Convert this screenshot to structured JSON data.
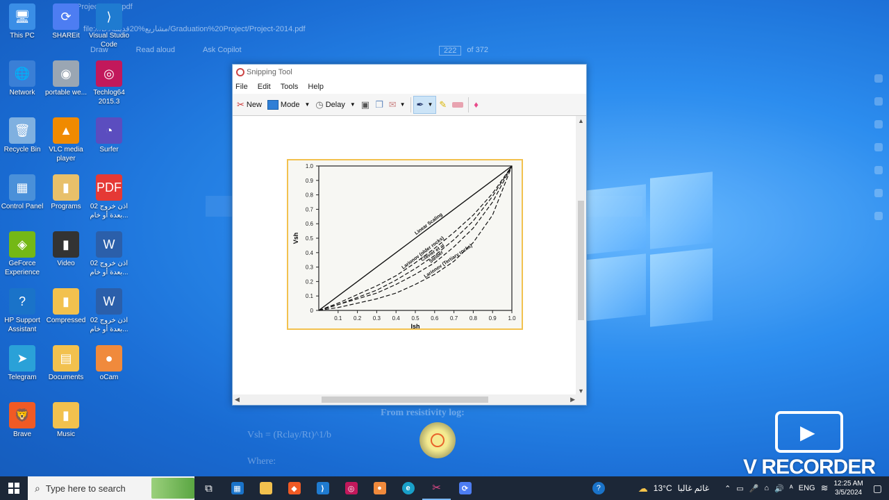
{
  "browser": {
    "tab_title": "Project-2014.pdf",
    "address": "file:///D:/مشاريع%20قديمة/Graduation%20Project/Project-2014.pdf",
    "toolbar": [
      "Draw",
      "Read aloud",
      "Ask Copilot"
    ],
    "page_current": "222",
    "page_total": "of 372",
    "doc_heading": "From resistivity log:",
    "doc_formula": "Vsh = (Rclay/Rt)^1/b",
    "doc_where": "Where:"
  },
  "desktop_icons": [
    {
      "label": "This PC",
      "color": "#3a8ee6",
      "glyph": "🖥"
    },
    {
      "label": "SHAREit",
      "color": "#4d7df2",
      "glyph": "⟳"
    },
    {
      "label": "Visual Studio Code",
      "color": "#1f7bd0",
      "glyph": "⟩"
    },
    {
      "label": "Network",
      "color": "#3a7fd6",
      "glyph": "🌐"
    },
    {
      "label": "portable we...",
      "color": "#9aa6b3",
      "glyph": "◉"
    },
    {
      "label": "Techlog64 2015.3",
      "color": "#c2185b",
      "glyph": "◎"
    },
    {
      "label": "Recycle Bin",
      "color": "#7fb0e0",
      "glyph": "🗑"
    },
    {
      "label": "VLC media player",
      "color": "#f08a00",
      "glyph": "▲"
    },
    {
      "label": "Surfer",
      "color": "#5b4dbf",
      "glyph": "◔"
    },
    {
      "label": "Control Panel",
      "color": "#4a90d9",
      "glyph": "▦"
    },
    {
      "label": "Programs",
      "color": "#e8c06a",
      "glyph": "▮"
    },
    {
      "label": "اذن خروج 02 ...بعدة أو خام",
      "color": "#e53935",
      "glyph": "PDF"
    },
    {
      "label": "GeForce Experience",
      "color": "#74b816",
      "glyph": "◈"
    },
    {
      "label": "Video",
      "color": "#333333",
      "glyph": "▮"
    },
    {
      "label": "اذن خروج 02 ...بعدة أو خام",
      "color": "#2b5faa",
      "glyph": "W"
    },
    {
      "label": "HP Support Assistant",
      "color": "#1a73c9",
      "glyph": "?"
    },
    {
      "label": "Compressed",
      "color": "#f2c14e",
      "glyph": "▮"
    },
    {
      "label": "اذن خروج 02 ...بعدة أو خام",
      "color": "#2b5faa",
      "glyph": "W"
    },
    {
      "label": "Telegram",
      "color": "#2aa1d8",
      "glyph": "➤"
    },
    {
      "label": "Documents",
      "color": "#f2c14e",
      "glyph": "▤"
    },
    {
      "label": "oCam",
      "color": "#f08a3c",
      "glyph": "●"
    },
    {
      "label": "Brave",
      "color": "#f05a24",
      "glyph": "🦁"
    },
    {
      "label": "Music",
      "color": "#f2c14e",
      "glyph": "▮"
    }
  ],
  "snipping": {
    "title": "Snipping Tool",
    "menu": [
      "File",
      "Edit",
      "Tools",
      "Help"
    ],
    "new_label": "New",
    "mode_label": "Mode",
    "delay_label": "Delay"
  },
  "chart_data": {
    "type": "line",
    "xlabel": "Ish",
    "ylabel": "Vsh",
    "xlim": [
      0,
      1.0
    ],
    "ylim": [
      0,
      1.0
    ],
    "x_ticks": [
      "0.1",
      "0.2",
      "0.3",
      "0.4",
      "0.5",
      "0.6",
      "0.7",
      "0.8",
      "0.9",
      "1.0"
    ],
    "y_ticks": [
      "0",
      "0.1",
      "0.2",
      "0.3",
      "0.4",
      "0.5",
      "0.6",
      "0.7",
      "0.8",
      "0.9",
      "1.0"
    ],
    "x": [
      0,
      0.1,
      0.2,
      0.3,
      0.4,
      0.5,
      0.6,
      0.7,
      0.8,
      0.9,
      1.0
    ],
    "series": [
      {
        "name": "Linear Scaling",
        "style": "solid",
        "values": [
          0,
          0.1,
          0.2,
          0.3,
          0.4,
          0.5,
          0.6,
          0.7,
          0.8,
          0.9,
          1.0
        ]
      },
      {
        "name": "Larionov (older rocks)",
        "style": "dashed",
        "values": [
          0,
          0.05,
          0.11,
          0.17,
          0.24,
          0.33,
          0.43,
          0.54,
          0.66,
          0.81,
          1.0
        ]
      },
      {
        "name": "Clavier et al",
        "style": "dashed",
        "values": [
          0,
          0.04,
          0.09,
          0.14,
          0.21,
          0.29,
          0.38,
          0.49,
          0.62,
          0.79,
          1.0
        ]
      },
      {
        "name": "Steiber",
        "style": "dashed",
        "values": [
          0,
          0.04,
          0.08,
          0.12,
          0.18,
          0.25,
          0.33,
          0.44,
          0.57,
          0.75,
          1.0
        ]
      },
      {
        "name": "Larionov (Tertiary rocks)",
        "style": "dashed",
        "values": [
          0,
          0.02,
          0.05,
          0.08,
          0.12,
          0.18,
          0.25,
          0.34,
          0.47,
          0.66,
          1.0
        ]
      }
    ],
    "grid": false
  },
  "recorder": {
    "label": "V RECORDER"
  },
  "taskbar": {
    "search_placeholder": "Type here to search",
    "weather": "13°C",
    "weather_text": "غائم غالبا",
    "lang": "ENG",
    "time": "12:25 AM",
    "date": "3/5/2024"
  }
}
